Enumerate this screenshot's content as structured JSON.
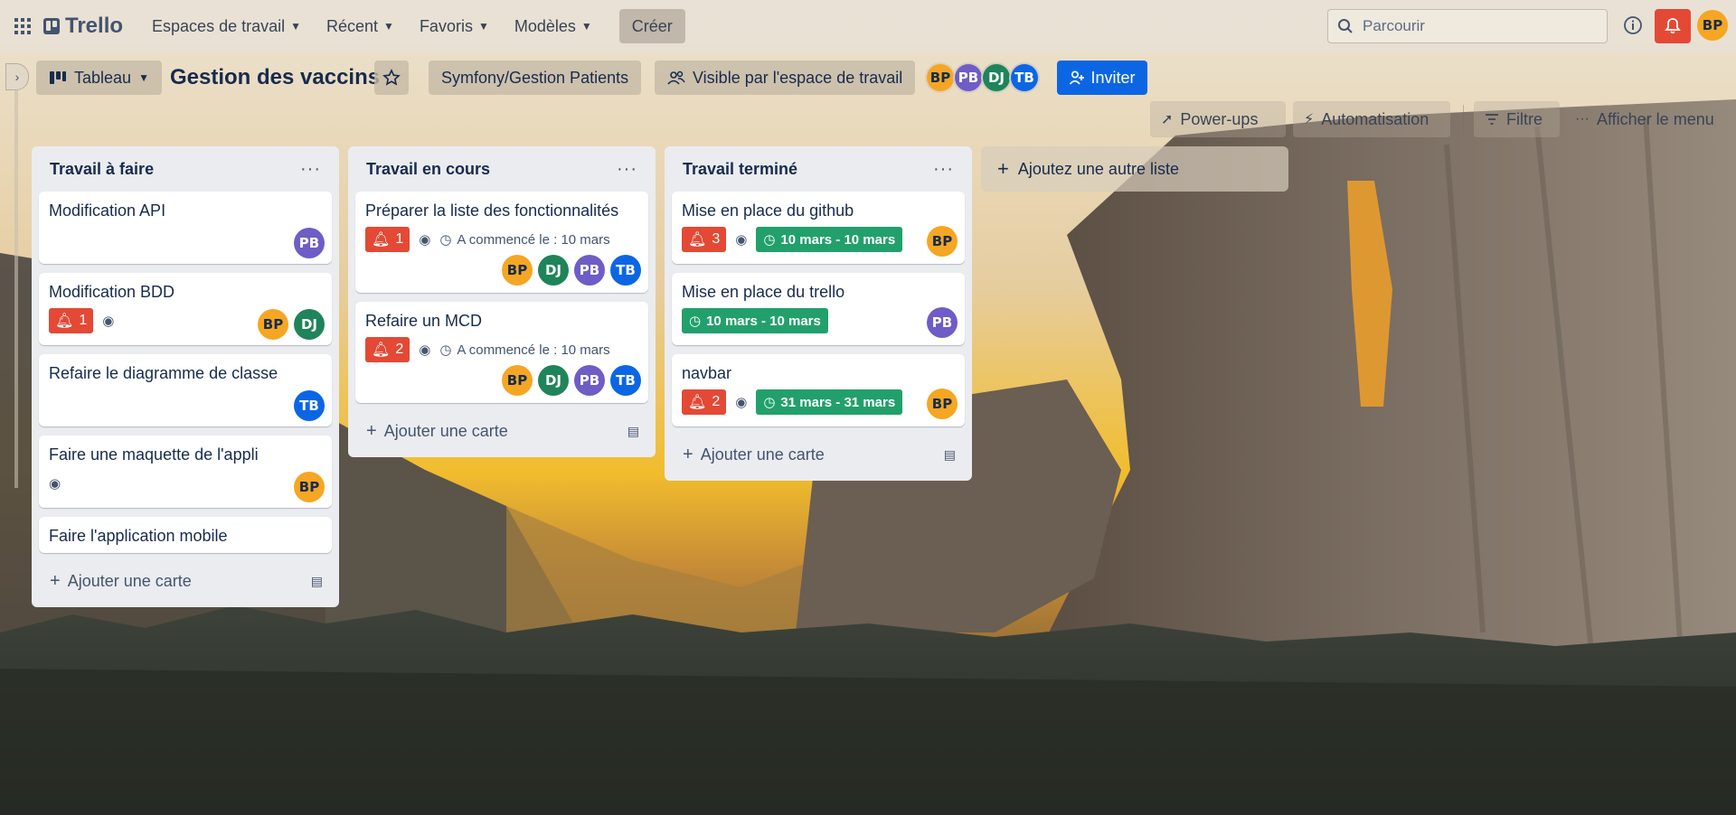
{
  "topnav": {
    "app_name": "Trello",
    "menu": [
      {
        "label": "Espaces de travail"
      },
      {
        "label": "Récent"
      },
      {
        "label": "Favoris"
      },
      {
        "label": "Modèles"
      }
    ],
    "create_label": "Créer",
    "search_placeholder": "Parcourir",
    "user_initials": "BP"
  },
  "board": {
    "view_label": "Tableau",
    "title": "Gestion des vaccins",
    "workspace_label": "Symfony/Gestion Patients",
    "visibility_label": "Visible par l'espace de travail",
    "invite_label": "Inviter",
    "members": [
      "BP",
      "PB",
      "DJ",
      "TB"
    ],
    "toolbar": {
      "powerups": "Power-ups",
      "automation": "Automatisation",
      "filter": "Filtre",
      "menu": "Afficher le menu"
    }
  },
  "lists": [
    {
      "title": "Travail à faire",
      "add_card": "Ajouter une carte",
      "cards": [
        {
          "title": "Modification API",
          "members": [
            "PB"
          ]
        },
        {
          "title": "Modification BDD",
          "notifications": "1",
          "watch": true,
          "members": [
            "BP",
            "DJ"
          ]
        },
        {
          "title": "Refaire le diagramme de classe",
          "members": [
            "TB"
          ]
        },
        {
          "title": "Faire une maquette de l'appli",
          "watch": true,
          "members": [
            "BP"
          ]
        },
        {
          "title": "Faire l'application mobile"
        }
      ]
    },
    {
      "title": "Travail en cours",
      "add_card": "Ajouter une carte",
      "cards": [
        {
          "title": "Préparer la liste des fonctionnalités",
          "notifications": "1",
          "watch": true,
          "start": "A commencé le : 10 mars",
          "members": [
            "BP",
            "DJ",
            "PB",
            "TB"
          ]
        },
        {
          "title": "Refaire un MCD",
          "notifications": "2",
          "watch": true,
          "start": "A commencé le : 10 mars",
          "members": [
            "BP",
            "DJ",
            "PB",
            "TB"
          ]
        }
      ]
    },
    {
      "title": "Travail terminé",
      "add_card": "Ajouter une carte",
      "cards": [
        {
          "title": "Mise en place du github",
          "notifications": "3",
          "watch": true,
          "dates": "10 mars - 10 mars",
          "members": [
            "BP"
          ]
        },
        {
          "title": "Mise en place du trello",
          "dates": "10 mars - 10 mars",
          "members": [
            "PB"
          ]
        },
        {
          "title": "navbar",
          "notifications": "2",
          "watch": true,
          "dates": "31 mars - 31 mars",
          "members": [
            "BP"
          ]
        }
      ]
    }
  ],
  "add_list_label": "Ajoutez une autre liste",
  "colors": {
    "accent": "#0c66e4",
    "alert": "#e34935",
    "done": "#22a06b",
    "list_bg": "#ebecf0"
  }
}
